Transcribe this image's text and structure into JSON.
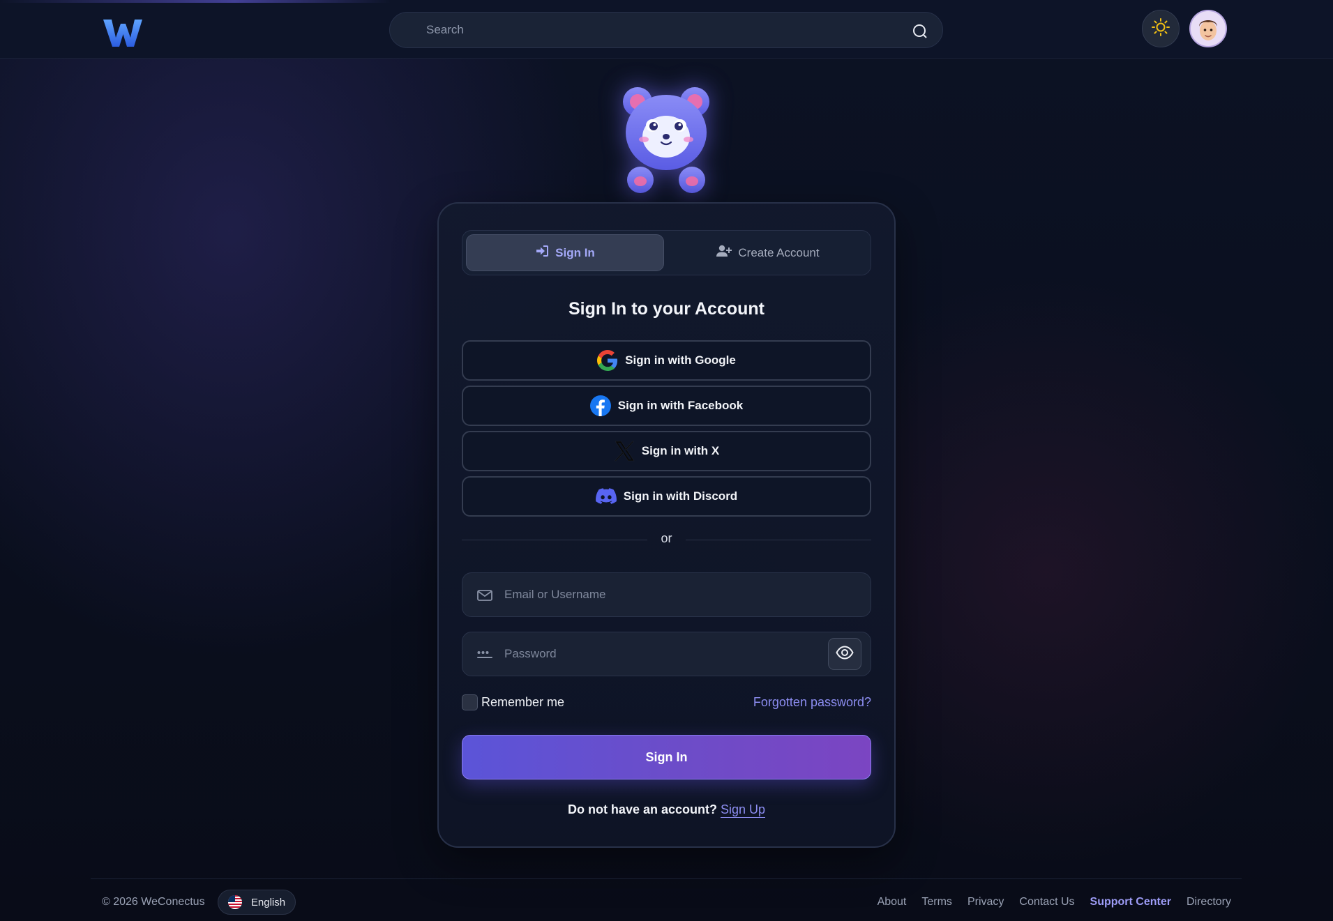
{
  "header": {
    "search_placeholder": "Search",
    "icons": {
      "logo": "weconectus-w-logo",
      "search": "search-icon",
      "theme": "sun-icon",
      "avatar": "user-avatar"
    }
  },
  "tabs": {
    "signin_label": "Sign In",
    "create_label": "Create Account"
  },
  "card": {
    "title": "Sign In to your Account",
    "social": [
      {
        "label": "Sign in with Google",
        "icon": "google-icon"
      },
      {
        "label": "Sign in with Facebook",
        "icon": "facebook-icon"
      },
      {
        "label": "Sign in with X",
        "icon": "x-icon"
      },
      {
        "label": "Sign in with Discord",
        "icon": "discord-icon"
      }
    ],
    "divider_text": "or",
    "email_placeholder": "Email or Username",
    "password_placeholder": "Password",
    "remember_label": "Remember me",
    "forgot_label": "Forgotten password?",
    "submit_label": "Sign In",
    "no_account_text": "Do not have an account?",
    "signup_label": "Sign Up"
  },
  "footer": {
    "copyright": "© 2026 WeConectus",
    "language": "English",
    "links": [
      "About",
      "Terms",
      "Privacy",
      "Contact Us",
      "Support Center",
      "Directory"
    ]
  },
  "colors": {
    "accent": "#8d8ef2",
    "button_start": "#5b54d8",
    "button_end": "#7b45c2",
    "background": "#0a0f1e"
  }
}
